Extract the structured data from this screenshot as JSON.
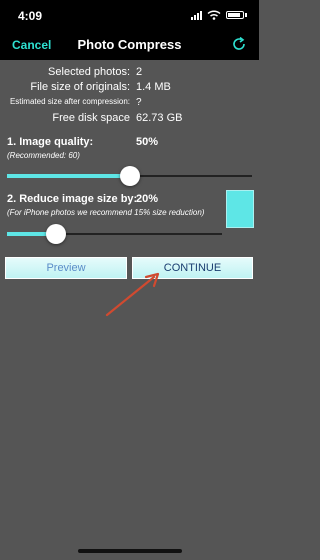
{
  "status_bar": {
    "time": "4:09"
  },
  "nav": {
    "cancel": "Cancel",
    "title": "Photo Compress"
  },
  "info": [
    {
      "label": "Selected photos:",
      "value": "2"
    },
    {
      "label": "File size of originals:",
      "value": "1.4 MB"
    },
    {
      "label": "Estimated size after compression:",
      "value": "?"
    },
    {
      "label": "Free disk space",
      "value": "62.73 GB"
    }
  ],
  "quality": {
    "title": "1. Image quality:",
    "value": "50%",
    "note": "(Recommended: 60)",
    "slider_fraction": 0.5
  },
  "reduce": {
    "title": "2. Reduce image size by:",
    "value": "20%",
    "note": "(For iPhone photos we recommend 15% size reduction)",
    "slider_fraction": 0.2
  },
  "buttons": {
    "preview": "Preview",
    "continue": "CONTINUE"
  },
  "colors": {
    "accent": "#2ee0d0",
    "slider": "#5ee6e6",
    "background": "#555555"
  },
  "icons": [
    "signal-icon",
    "wifi-icon",
    "battery-icon",
    "refresh-icon",
    "annotation-arrow"
  ]
}
